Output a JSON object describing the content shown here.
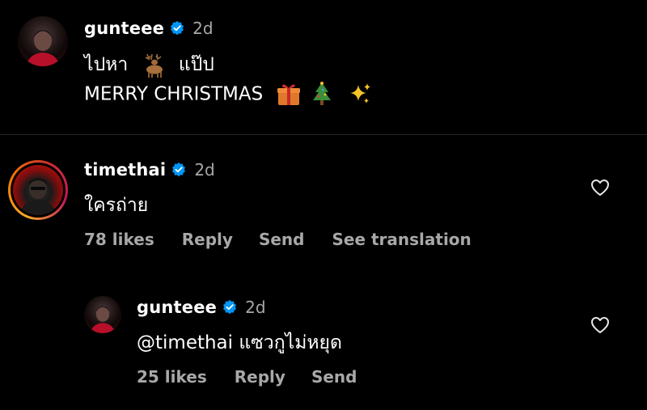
{
  "caption": {
    "username": "gunteee",
    "time": "2d",
    "line1_part1": "ไปหา",
    "line1_part2": "แป๊ป",
    "line2": "MERRY CHRISTMAS"
  },
  "comments": [
    {
      "username": "timethai",
      "time": "2d",
      "text": "ใครถ่าย",
      "likes": "78 likes",
      "reply_label": "Reply",
      "send_label": "Send",
      "translate_label": "See translation"
    },
    {
      "username": "gunteee",
      "time": "2d",
      "text": "@timethai แซวกูไม่หยุด",
      "likes": "25 likes",
      "reply_label": "Reply",
      "send_label": "Send"
    }
  ],
  "colors": {
    "background": "#000000",
    "secondary_text": "#a8a8a8",
    "verified_blue": "#0095f6",
    "divider": "#262626"
  },
  "icons": {
    "verified": "verified-badge-icon",
    "heart": "heart-outline-icon",
    "emoji": [
      "deer-emoji",
      "gift-emoji",
      "christmas-tree-emoji",
      "sparkles-emoji"
    ]
  }
}
